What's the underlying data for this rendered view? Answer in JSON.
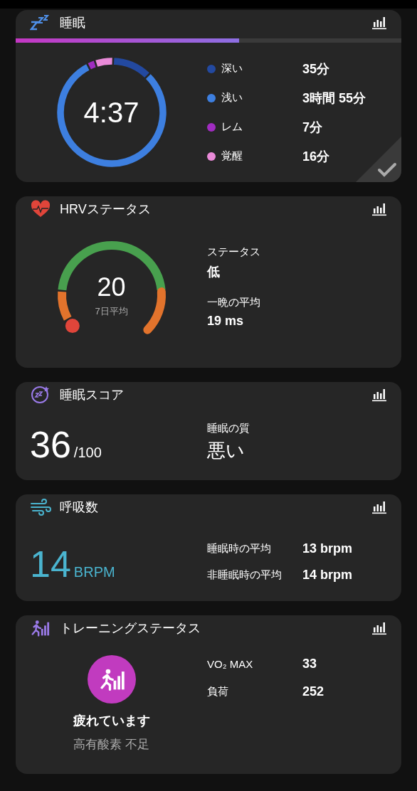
{
  "sleep": {
    "title": "睡眠",
    "progress": {
      "level": 0.58
    },
    "total": "4:37",
    "chart_data": {
      "type": "donut",
      "categories": [
        "深い",
        "浅い",
        "レム",
        "覚醒"
      ],
      "values": [
        11.95,
        80.2,
        2.39,
        5.46
      ]
    },
    "stages": [
      {
        "value": "35分",
        "color": "#2349a0"
      },
      {
        "value": "3時間 55分",
        "color": "#3d7fe0"
      },
      {
        "value": "7分",
        "color": "#a02cc0"
      },
      {
        "value": "16分",
        "color": "#e98ad8"
      }
    ]
  },
  "hrv": {
    "title": "HRVステータス",
    "value": "20",
    "caption": "7日平均",
    "stats": [
      {
        "label": "ステータス",
        "value": "低"
      },
      {
        "label": "一晩の平均",
        "value": "19 ms"
      }
    ]
  },
  "sleep_score": {
    "title": "睡眠スコア",
    "score": "36",
    "max": "/100",
    "quality_label": "睡眠の質",
    "quality": "悪い"
  },
  "respiration": {
    "title": "呼吸数",
    "value": "14",
    "unit": "BRPM",
    "stats": [
      {
        "label": "睡眠時の平均",
        "value": "13 brpm"
      },
      {
        "label": "非睡眠時の平均",
        "value": "14 brpm"
      }
    ]
  },
  "training": {
    "title": "トレーニングステータス",
    "status": "疲れています",
    "detail": "高有酸素 不足",
    "stats": [
      {
        "label": "VO₂ MAX",
        "value": "33"
      },
      {
        "label": "負荷",
        "value": "252"
      }
    ]
  }
}
